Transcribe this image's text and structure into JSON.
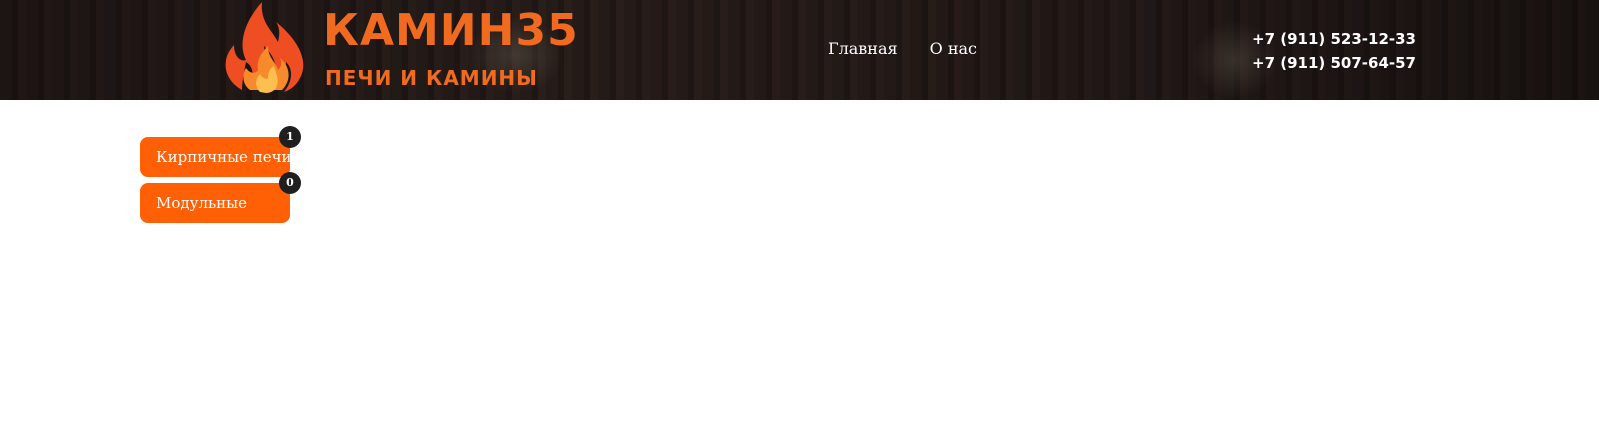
{
  "header": {
    "logo": {
      "title": "КАМИН35",
      "subtitle": "ПЕЧИ И КАМИНЫ",
      "icon": "flame-icon"
    },
    "nav": [
      {
        "label": "Главная"
      },
      {
        "label": "О нас"
      }
    ],
    "phones": [
      "+7 (911) 523-12-33",
      "+7 (911) 507-64-57"
    ]
  },
  "categories": [
    {
      "label": "Кирпичные печи",
      "count": "1"
    },
    {
      "label": "Модульные",
      "count": "0"
    }
  ],
  "colors": {
    "accent": "#ff5f05",
    "logo_orange": "#f06a1f",
    "header_bg": "#2a1f1c",
    "badge_bg": "#1f1f1f"
  }
}
